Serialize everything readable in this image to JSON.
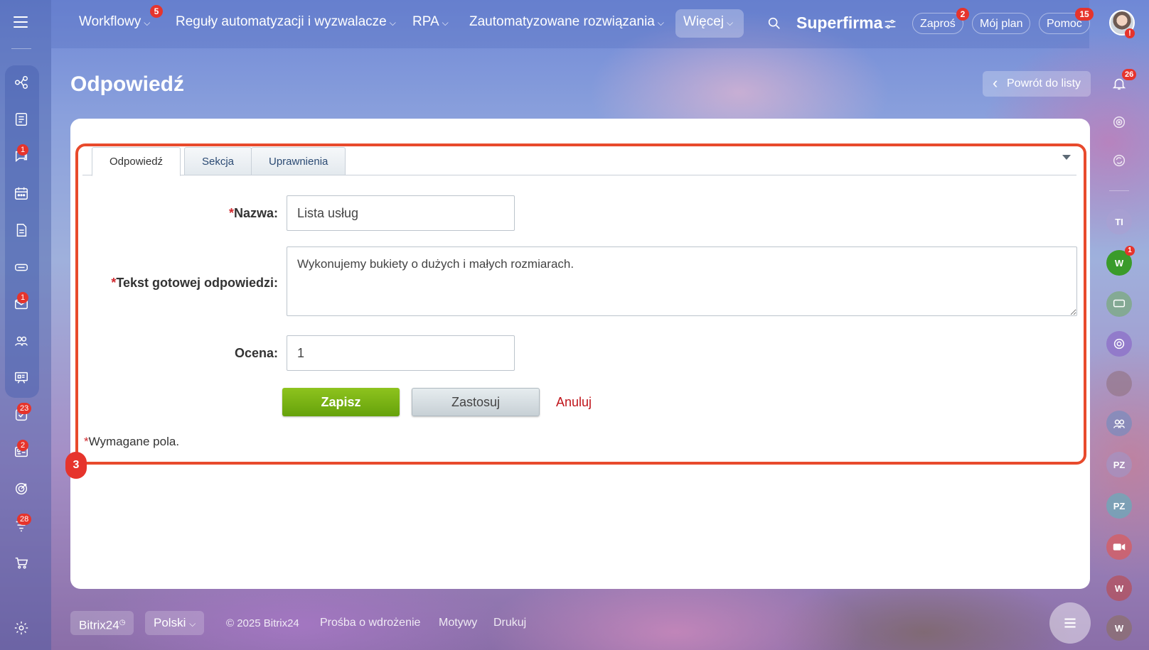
{
  "topnav": {
    "items": [
      {
        "label": "Workflowy",
        "badge": "5"
      },
      {
        "label": "Reguły automatyzacji i wyzwalacze"
      },
      {
        "label": "RPA"
      },
      {
        "label": "Zautomatyzowane rozwiązania"
      },
      {
        "label": "Więcej"
      }
    ],
    "brand": "Superfirma",
    "invite_label": "Zaproś",
    "invite_badge": "2",
    "plan_label": "Mój plan",
    "help_label": "Pomoc",
    "help_badge": "15"
  },
  "left_badges": {
    "chat": "1",
    "mail": "1",
    "tasks": "23",
    "news": "2",
    "feed": "28"
  },
  "page": {
    "title": "Odpowiedź",
    "back_label": "Powrót do listy"
  },
  "tabs": [
    {
      "label": "Odpowiedź"
    },
    {
      "label": "Sekcja"
    },
    {
      "label": "Uprawnienia"
    }
  ],
  "form": {
    "name_label": "Nazwa:",
    "name_value": "Lista usług",
    "text_label": "Tekst gotowej odpowiedzi:",
    "text_value": "Wykonujemy bukiety o dużych i małych rozmiarach.",
    "rating_label": "Ocena:",
    "rating_value": "1",
    "required_mark": "*",
    "save_label": "Zapisz",
    "apply_label": "Zastosuj",
    "cancel_label": "Anuluj",
    "required_note": "Wymagane pola."
  },
  "step_marker": "3",
  "right_bar": {
    "notif_badge": "26",
    "avatars": [
      "TI",
      "W",
      "PZ",
      "PZ",
      "W",
      "W"
    ],
    "w_badge": "1"
  },
  "footer": {
    "brand": "Bitrix24",
    "language": "Polski",
    "copyright": "© 2025 Bitrix24",
    "link_implementation": "Prośba o wdrożenie",
    "link_themes": "Motywy",
    "link_print": "Drukuj"
  },
  "colors": {
    "required": "#d0292e",
    "save_button": "#74ad14",
    "highlight": "#e84a2c",
    "badge": "#e6342c"
  }
}
